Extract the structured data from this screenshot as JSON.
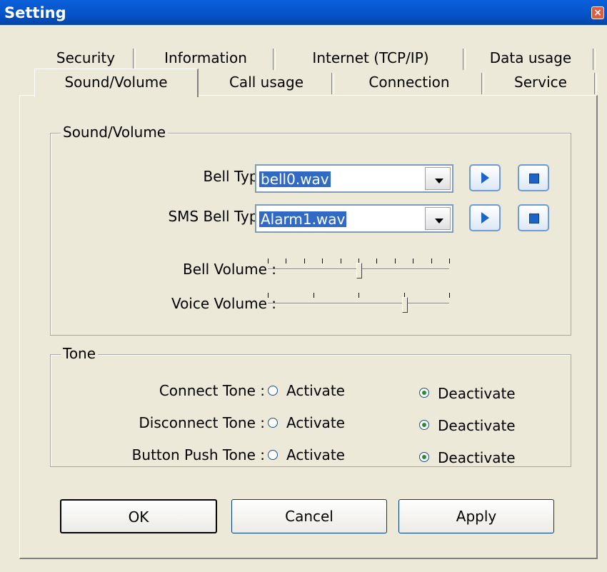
{
  "window": {
    "title": "Setting"
  },
  "tabs_row1": [
    "Security",
    "Information",
    "Internet (TCP/IP)",
    "Data usage"
  ],
  "tabs_row2": [
    "Sound/Volume",
    "Call usage",
    "Connection",
    "Service"
  ],
  "active_tab": "Sound/Volume",
  "sound_group": {
    "legend": "Sound/Volume",
    "bell_type_label": "Bell Type :",
    "bell_type_value": "bell0.wav",
    "sms_bell_type_label": "SMS Bell Type :",
    "sms_bell_type_value": "Alarm1.wav",
    "bell_volume_label": "Bell Volume :",
    "bell_volume_level": 0.5,
    "voice_volume_label": "Voice Volume :",
    "voice_volume_level": 0.75
  },
  "tone_group": {
    "legend": "Tone",
    "rows": [
      {
        "label": "Connect Tone :",
        "activate": "Activate",
        "deactivate": "Deactivate",
        "selected": "Deactivate"
      },
      {
        "label": "Disconnect Tone :",
        "activate": "Activate",
        "deactivate": "Deactivate",
        "selected": "Deactivate"
      },
      {
        "label": "Button Push Tone :",
        "activate": "Activate",
        "deactivate": "Deactivate",
        "selected": "Deactivate"
      }
    ]
  },
  "buttons": {
    "ok": "OK",
    "cancel": "Cancel",
    "apply": "Apply"
  },
  "icons": {
    "play": "play-icon",
    "stop": "stop-icon",
    "close": "close-icon"
  }
}
